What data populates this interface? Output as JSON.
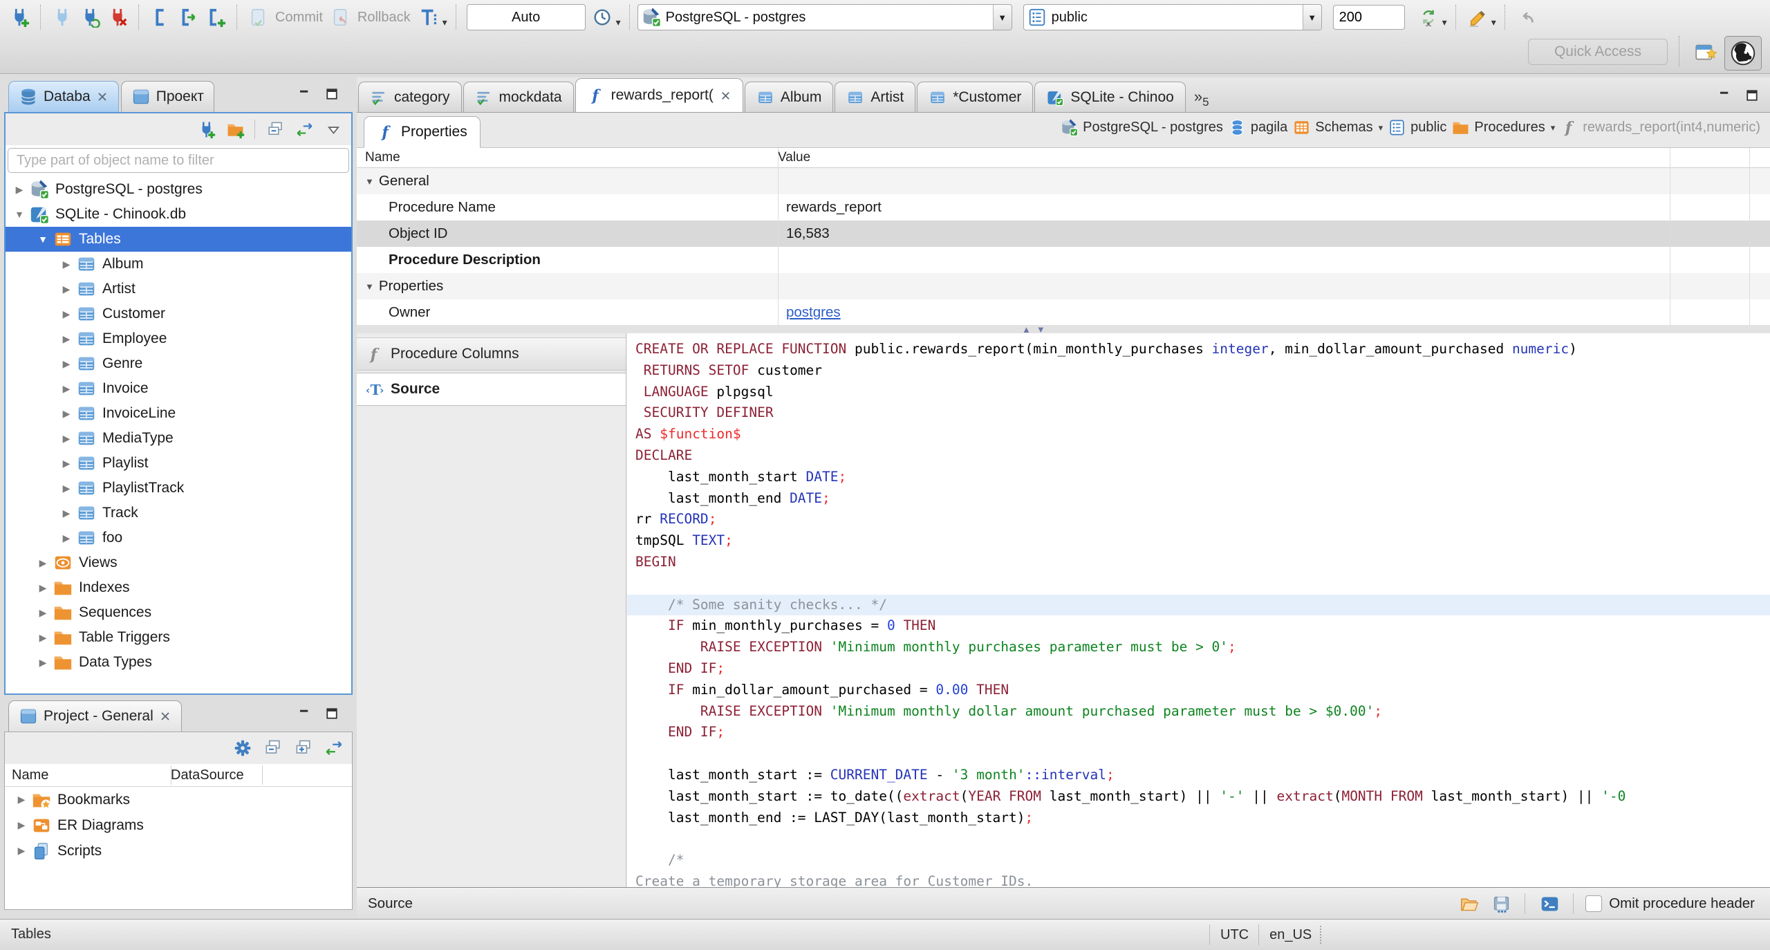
{
  "window": {
    "quick_access_placeholder": "Quick Access"
  },
  "toolbar": {
    "commit_label": "Commit",
    "rollback_label": "Rollback",
    "auto_value": "Auto",
    "connection_value": "PostgreSQL - postgres",
    "schema_value": "public",
    "fetch_size_value": "200"
  },
  "left_panel": {
    "tabs": [
      {
        "label": "Databa"
      },
      {
        "label": "Проект"
      }
    ],
    "filter_placeholder": "Type part of object name to filter",
    "tree": [
      {
        "label": "PostgreSQL - postgres",
        "icon": "postgres-db",
        "level": 0,
        "arrow": "collapsed"
      },
      {
        "label": "SQLite - Chinook.db",
        "icon": "sqlite-db",
        "level": 0,
        "arrow": "expanded"
      },
      {
        "label": "Tables",
        "icon": "tables-folder",
        "level": 1,
        "arrow": "expanded",
        "selected": true
      },
      {
        "label": "Album",
        "icon": "table",
        "level": 2,
        "arrow": "collapsed"
      },
      {
        "label": "Artist",
        "icon": "table",
        "level": 2,
        "arrow": "collapsed"
      },
      {
        "label": "Customer",
        "icon": "table",
        "level": 2,
        "arrow": "collapsed"
      },
      {
        "label": "Employee",
        "icon": "table",
        "level": 2,
        "arrow": "collapsed"
      },
      {
        "label": "Genre",
        "icon": "table",
        "level": 2,
        "arrow": "collapsed"
      },
      {
        "label": "Invoice",
        "icon": "table",
        "level": 2,
        "arrow": "collapsed"
      },
      {
        "label": "InvoiceLine",
        "icon": "table",
        "level": 2,
        "arrow": "collapsed"
      },
      {
        "label": "MediaType",
        "icon": "table",
        "level": 2,
        "arrow": "collapsed"
      },
      {
        "label": "Playlist",
        "icon": "table",
        "level": 2,
        "arrow": "collapsed"
      },
      {
        "label": "PlaylistTrack",
        "icon": "table",
        "level": 2,
        "arrow": "collapsed"
      },
      {
        "label": "Track",
        "icon": "table",
        "level": 2,
        "arrow": "collapsed"
      },
      {
        "label": "foo",
        "icon": "table",
        "level": 2,
        "arrow": "collapsed"
      },
      {
        "label": "Views",
        "icon": "views",
        "level": 1,
        "arrow": "collapsed"
      },
      {
        "label": "Indexes",
        "icon": "folder",
        "level": 1,
        "arrow": "collapsed"
      },
      {
        "label": "Sequences",
        "icon": "folder",
        "level": 1,
        "arrow": "collapsed"
      },
      {
        "label": "Table Triggers",
        "icon": "folder",
        "level": 1,
        "arrow": "collapsed"
      },
      {
        "label": "Data Types",
        "icon": "folder",
        "level": 1,
        "arrow": "collapsed"
      }
    ]
  },
  "project_panel": {
    "title": "Project - General",
    "columns": [
      "Name",
      "DataSource"
    ],
    "items": [
      {
        "label": "Bookmarks",
        "icon": "folder-star"
      },
      {
        "label": "ER Diagrams",
        "icon": "er-diagram"
      },
      {
        "label": "Scripts",
        "icon": "scripts"
      }
    ]
  },
  "editor": {
    "tabs": [
      {
        "label": "category",
        "icon": "sql-script"
      },
      {
        "label": "mockdata",
        "icon": "sql-script"
      },
      {
        "label": "rewards_report(",
        "icon": "function",
        "active": true,
        "closable": true
      },
      {
        "label": "Album",
        "icon": "table"
      },
      {
        "label": "Artist",
        "icon": "table"
      },
      {
        "label": "*Customer",
        "icon": "table"
      },
      {
        "label": "SQLite - Chinoo",
        "icon": "sqlite-db"
      }
    ],
    "overflow_count": "5",
    "subtab": "Properties",
    "breadcrumb": [
      {
        "label": "PostgreSQL - postgres",
        "icon": "postgres-db"
      },
      {
        "label": "pagila",
        "icon": "database"
      },
      {
        "label": "Schemas",
        "icon": "schemas-folder",
        "dropdown": true
      },
      {
        "label": "public",
        "icon": "schema"
      },
      {
        "label": "Procedures",
        "icon": "folder",
        "dropdown": true
      },
      {
        "label": "rewards_report(int4,numeric)",
        "icon": "function-gray",
        "muted": true
      }
    ],
    "properties_grid": {
      "columns": [
        "Name",
        "Value"
      ],
      "rows": [
        {
          "name": "General",
          "type": "group",
          "expanded": true
        },
        {
          "name": "Procedure Name",
          "value": "rewards_report"
        },
        {
          "name": "Object ID",
          "value": "16,583",
          "selected": true
        },
        {
          "name": "Procedure Description",
          "value": "",
          "bold": true
        },
        {
          "name": "Properties",
          "type": "group",
          "expanded": true
        },
        {
          "name": "Owner",
          "value": "postgres",
          "link": true
        }
      ]
    },
    "side_tabs": [
      {
        "label": "Procedure Columns",
        "icon": "function-gray"
      },
      {
        "label": "Source",
        "icon": "source-T",
        "active": true
      }
    ],
    "bottom_bar": {
      "label": "Source",
      "omit_checkbox_label": "Omit procedure header"
    }
  },
  "statusbar": {
    "left": "Tables",
    "timezone": "UTC",
    "locale": "en_US"
  },
  "colors": {
    "selection_blue": "#3c76d9",
    "keyword": "#8c2135",
    "datatype": "#2433b8",
    "number": "#2441d8",
    "string": "#0e8420",
    "delimiter_red": "#ef2929",
    "comment": "#8b9198",
    "line_highlight": "#e5effc",
    "link": "#2a5cc8"
  },
  "source_code": {
    "lines": [
      {
        "seg": [
          {
            "t": "CREATE OR REPLACE FUNCTION ",
            "c": "k"
          },
          {
            "t": "public.rewards_report(min_monthly_purchases ",
            "c": "p"
          },
          {
            "t": "integer",
            "c": "t"
          },
          {
            "t": ", min_dollar_amount_purchased ",
            "c": "p"
          },
          {
            "t": "numeric",
            "c": "t"
          },
          {
            "t": ")",
            "c": "p"
          }
        ]
      },
      {
        "seg": [
          {
            "t": " RETURNS SETOF ",
            "c": "k"
          },
          {
            "t": "customer",
            "c": "p"
          }
        ]
      },
      {
        "seg": [
          {
            "t": " LANGUAGE ",
            "c": "k"
          },
          {
            "t": "plpgsql",
            "c": "p"
          }
        ]
      },
      {
        "seg": [
          {
            "t": " SECURITY DEFINER",
            "c": "k"
          }
        ]
      },
      {
        "seg": [
          {
            "t": "AS ",
            "c": "k"
          },
          {
            "t": "$function$",
            "c": "r"
          }
        ]
      },
      {
        "seg": [
          {
            "t": "DECLARE",
            "c": "k"
          }
        ]
      },
      {
        "seg": [
          {
            "t": "    last_month_start ",
            "c": "p"
          },
          {
            "t": "DATE",
            "c": "t"
          },
          {
            "t": ";",
            "c": "r"
          }
        ]
      },
      {
        "seg": [
          {
            "t": "    last_month_end ",
            "c": "p"
          },
          {
            "t": "DATE",
            "c": "t"
          },
          {
            "t": ";",
            "c": "r"
          }
        ]
      },
      {
        "seg": [
          {
            "t": "rr ",
            "c": "p"
          },
          {
            "t": "RECORD",
            "c": "t"
          },
          {
            "t": ";",
            "c": "r"
          }
        ]
      },
      {
        "seg": [
          {
            "t": "tmpSQL ",
            "c": "p"
          },
          {
            "t": "TEXT",
            "c": "t"
          },
          {
            "t": ";",
            "c": "r"
          }
        ]
      },
      {
        "seg": [
          {
            "t": "BEGIN",
            "c": "k"
          }
        ]
      },
      {
        "seg": []
      },
      {
        "hl": true,
        "seg": [
          {
            "t": "    /* Some sanity checks... */",
            "c": "c"
          }
        ]
      },
      {
        "seg": [
          {
            "t": "    IF",
            "c": "k"
          },
          {
            "t": " min_monthly_purchases = ",
            "c": "p"
          },
          {
            "t": "0",
            "c": "n"
          },
          {
            "t": " THEN",
            "c": "k"
          }
        ]
      },
      {
        "seg": [
          {
            "t": "        RAISE EXCEPTION ",
            "c": "k"
          },
          {
            "t": "'Minimum monthly purchases parameter must be > 0'",
            "c": "s"
          },
          {
            "t": ";",
            "c": "r"
          }
        ]
      },
      {
        "seg": [
          {
            "t": "    END IF",
            "c": "k"
          },
          {
            "t": ";",
            "c": "r"
          }
        ]
      },
      {
        "seg": [
          {
            "t": "    IF",
            "c": "k"
          },
          {
            "t": " min_dollar_amount_purchased = ",
            "c": "p"
          },
          {
            "t": "0.00",
            "c": "n"
          },
          {
            "t": " THEN",
            "c": "k"
          }
        ]
      },
      {
        "seg": [
          {
            "t": "        RAISE EXCEPTION ",
            "c": "k"
          },
          {
            "t": "'Minimum monthly dollar amount purchased parameter must be > $0.00'",
            "c": "s"
          },
          {
            "t": ";",
            "c": "r"
          }
        ]
      },
      {
        "seg": [
          {
            "t": "    END IF",
            "c": "k"
          },
          {
            "t": ";",
            "c": "r"
          }
        ]
      },
      {
        "seg": []
      },
      {
        "seg": [
          {
            "t": "    last_month_start := ",
            "c": "p"
          },
          {
            "t": "CURRENT_DATE",
            "c": "t"
          },
          {
            "t": " - ",
            "c": "p"
          },
          {
            "t": "'3 month'",
            "c": "s"
          },
          {
            "t": "::interval",
            "c": "t"
          },
          {
            "t": ";",
            "c": "r"
          }
        ]
      },
      {
        "seg": [
          {
            "t": "    last_month_start := to_date((",
            "c": "p"
          },
          {
            "t": "extract",
            "c": "k"
          },
          {
            "t": "(",
            "c": "p"
          },
          {
            "t": "YEAR FROM",
            "c": "k"
          },
          {
            "t": " last_month_start) || ",
            "c": "p"
          },
          {
            "t": "'-'",
            "c": "s"
          },
          {
            "t": " || ",
            "c": "p"
          },
          {
            "t": "extract",
            "c": "k"
          },
          {
            "t": "(",
            "c": "p"
          },
          {
            "t": "MONTH FROM",
            "c": "k"
          },
          {
            "t": " last_month_start) || ",
            "c": "p"
          },
          {
            "t": "'-0",
            "c": "s"
          }
        ]
      },
      {
        "seg": [
          {
            "t": "    last_month_end := LAST_DAY(last_month_start)",
            "c": "p"
          },
          {
            "t": ";",
            "c": "r"
          }
        ]
      },
      {
        "seg": []
      },
      {
        "seg": [
          {
            "t": "    /*",
            "c": "c"
          }
        ]
      },
      {
        "seg": [
          {
            "t": "Create a temporary storage area for Customer IDs.",
            "c": "c"
          }
        ]
      },
      {
        "seg": [
          {
            "t": "*/",
            "c": "c"
          }
        ]
      }
    ]
  }
}
